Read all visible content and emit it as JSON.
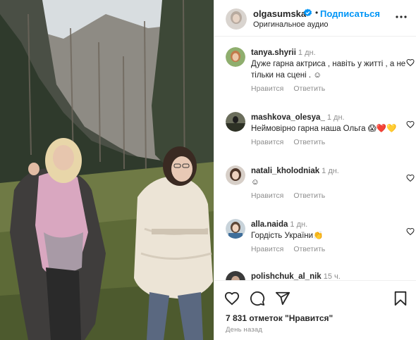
{
  "header": {
    "username": "olgasumska",
    "separator": "•",
    "follow_label": "Подписаться",
    "audio_label": "Оригинальное аудио"
  },
  "comments": [
    {
      "user": "tanya.shyrii",
      "time": "1 дн.",
      "text": "Дуже гарна актриса , навіть у житті , а не тільки на сцені . ☺",
      "like_label": "Нравится",
      "reply_label": "Ответить"
    },
    {
      "user": "mashkova_olesya_",
      "time": "1 дн.",
      "text": "Неймовірно гарна наша Ольга 😱❤️💛",
      "like_label": "Нравится",
      "reply_label": "Ответить"
    },
    {
      "user": "natali_kholodniak",
      "time": "1 дн.",
      "text": "☺",
      "like_label": "Нравится",
      "reply_label": "Ответить"
    },
    {
      "user": "alla.naida",
      "time": "1 дн.",
      "text": "Гордість України👏",
      "like_label": "Нравится",
      "reply_label": "Ответить"
    },
    {
      "user": "polishchuk_al_nik",
      "time": "15 ч.",
      "text": "",
      "like_label": "",
      "reply_label": ""
    }
  ],
  "footer": {
    "likes_text": "7 831 отметок \"Нравится\"",
    "date_text": "День назад"
  },
  "icons": {
    "verified": "verified-badge-icon",
    "more": "more-options-icon",
    "like": "heart-icon",
    "comment": "comment-icon",
    "share": "share-icon",
    "save": "bookmark-icon"
  },
  "colors": {
    "accent": "#0095f6",
    "text": "#262626",
    "muted": "#8e8e8e",
    "border": "#efefef"
  }
}
